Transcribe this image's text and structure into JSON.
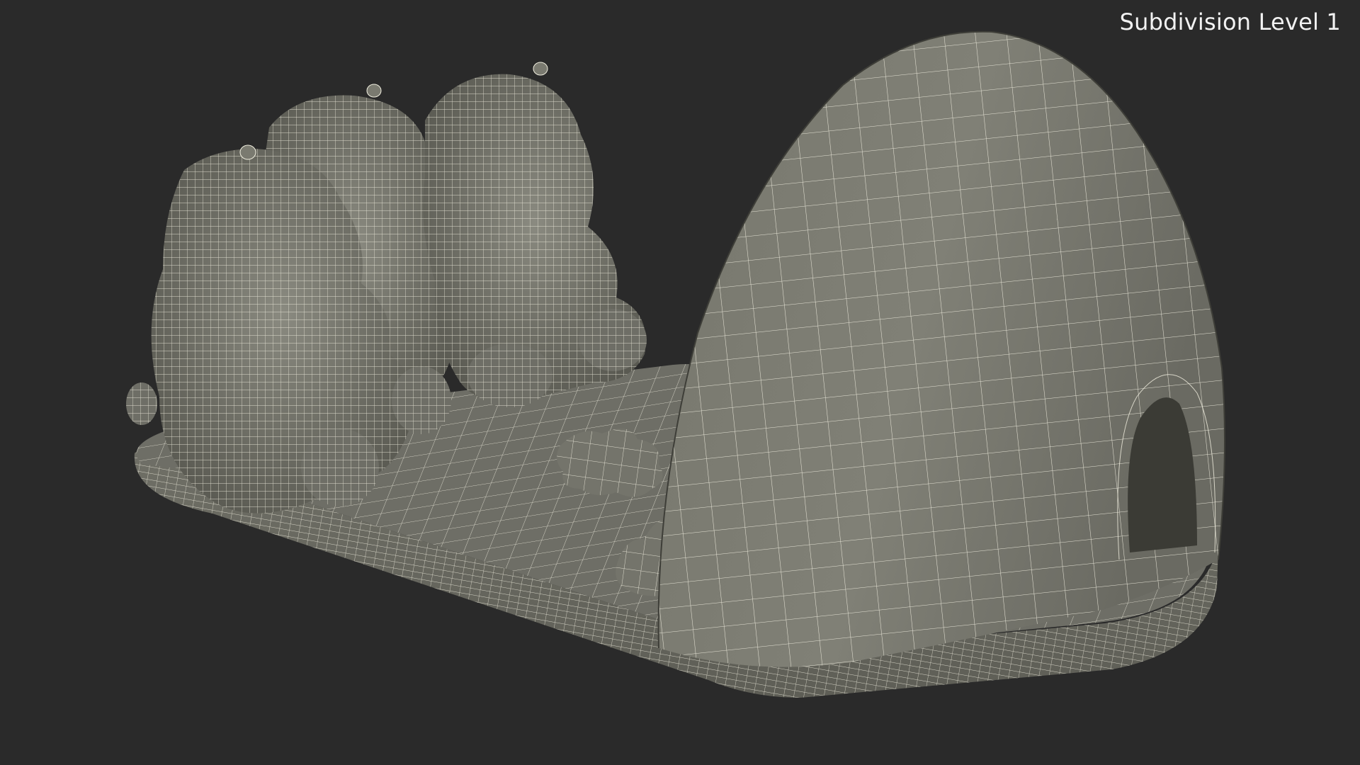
{
  "viewport": {
    "subdivision_label": "Subdivision Level 1"
  },
  "scene": {
    "background_color": "#2a2a2a",
    "surface_color": "#7a7a70",
    "wire_color": "#f4f2e4",
    "objects": [
      "bear",
      "bear",
      "bear",
      "igloo",
      "star",
      "star",
      "base"
    ]
  }
}
